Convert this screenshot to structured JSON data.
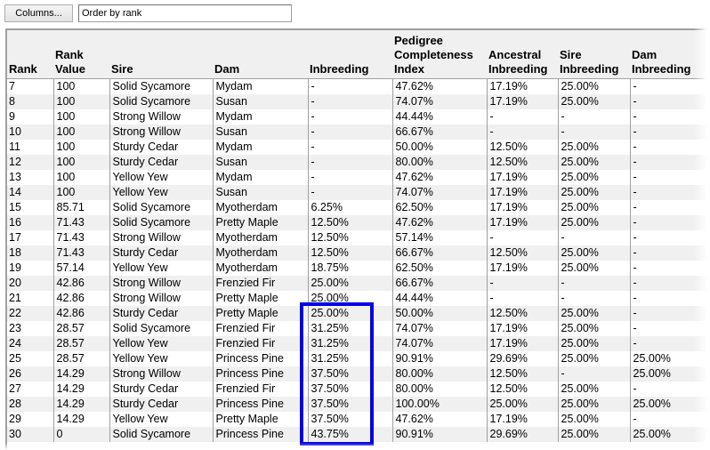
{
  "toolbar": {
    "columns_button": "Columns...",
    "order_field_value": "Order by rank"
  },
  "table": {
    "headers": [
      {
        "line1": "",
        "line2": "",
        "line3": "Rank"
      },
      {
        "line1": "",
        "line2": "Rank",
        "line3": "Value"
      },
      {
        "line1": "",
        "line2": "",
        "line3": "Sire"
      },
      {
        "line1": "",
        "line2": "",
        "line3": "Dam"
      },
      {
        "line1": "",
        "line2": "",
        "line3": "Inbreeding"
      },
      {
        "line1": "Pedigree",
        "line2": "Completeness",
        "line3": "Index"
      },
      {
        "line1": "",
        "line2": "Ancestral",
        "line3": "Inbreeding"
      },
      {
        "line1": "",
        "line2": "Sire",
        "line3": "Inbreeding"
      },
      {
        "line1": "",
        "line2": "Dam",
        "line3": "Inbreeding"
      }
    ],
    "rows": [
      [
        "7",
        "100",
        "Solid Sycamore",
        "Mydam",
        "-",
        "47.62%",
        "17.19%",
        "25.00%",
        "-"
      ],
      [
        "8",
        "100",
        "Solid Sycamore",
        "Susan",
        "-",
        "74.07%",
        "17.19%",
        "25.00%",
        "-"
      ],
      [
        "9",
        "100",
        "Strong Willow",
        "Mydam",
        "-",
        "44.44%",
        "-",
        "-",
        "-"
      ],
      [
        "10",
        "100",
        "Strong Willow",
        "Susan",
        "-",
        "66.67%",
        "-",
        "-",
        "-"
      ],
      [
        "11",
        "100",
        "Sturdy Cedar",
        "Mydam",
        "-",
        "50.00%",
        "12.50%",
        "25.00%",
        "-"
      ],
      [
        "12",
        "100",
        "Sturdy Cedar",
        "Susan",
        "-",
        "80.00%",
        "12.50%",
        "25.00%",
        "-"
      ],
      [
        "13",
        "100",
        "Yellow Yew",
        "Mydam",
        "-",
        "47.62%",
        "17.19%",
        "25.00%",
        "-"
      ],
      [
        "14",
        "100",
        "Yellow Yew",
        "Susan",
        "-",
        "74.07%",
        "17.19%",
        "25.00%",
        "-"
      ],
      [
        "15",
        "85.71",
        "Solid Sycamore",
        "Myotherdam",
        "6.25%",
        "62.50%",
        "17.19%",
        "25.00%",
        "-"
      ],
      [
        "16",
        "71.43",
        "Solid Sycamore",
        "Pretty Maple",
        "12.50%",
        "47.62%",
        "17.19%",
        "25.00%",
        "-"
      ],
      [
        "17",
        "71.43",
        "Strong Willow",
        "Myotherdam",
        "12.50%",
        "57.14%",
        "-",
        "-",
        "-"
      ],
      [
        "18",
        "71.43",
        "Sturdy Cedar",
        "Myotherdam",
        "12.50%",
        "66.67%",
        "12.50%",
        "25.00%",
        "-"
      ],
      [
        "19",
        "57.14",
        "Yellow Yew",
        "Myotherdam",
        "18.75%",
        "62.50%",
        "17.19%",
        "25.00%",
        "-"
      ],
      [
        "20",
        "42.86",
        "Strong Willow",
        "Frenzied Fir",
        "25.00%",
        "66.67%",
        "-",
        "-",
        "-"
      ],
      [
        "21",
        "42.86",
        "Strong Willow",
        "Pretty Maple",
        "25.00%",
        "44.44%",
        "-",
        "-",
        "-"
      ],
      [
        "22",
        "42.86",
        "Sturdy Cedar",
        "Pretty Maple",
        "25.00%",
        "50.00%",
        "12.50%",
        "25.00%",
        "-"
      ],
      [
        "23",
        "28.57",
        "Solid Sycamore",
        "Frenzied Fir",
        "31.25%",
        "74.07%",
        "17.19%",
        "25.00%",
        "-"
      ],
      [
        "24",
        "28.57",
        "Yellow Yew",
        "Frenzied Fir",
        "31.25%",
        "74.07%",
        "17.19%",
        "25.00%",
        "-"
      ],
      [
        "25",
        "28.57",
        "Yellow Yew",
        "Princess Pine",
        "31.25%",
        "90.91%",
        "29.69%",
        "25.00%",
        "25.00%"
      ],
      [
        "26",
        "14.29",
        "Strong Willow",
        "Princess Pine",
        "37.50%",
        "80.00%",
        "12.50%",
        "-",
        "25.00%"
      ],
      [
        "27",
        "14.29",
        "Sturdy Cedar",
        "Frenzied Fir",
        "37.50%",
        "80.00%",
        "12.50%",
        "25.00%",
        "-"
      ],
      [
        "28",
        "14.29",
        "Sturdy Cedar",
        "Princess Pine",
        "37.50%",
        "100.00%",
        "25.00%",
        "25.00%",
        "25.00%"
      ],
      [
        "29",
        "14.29",
        "Yellow Yew",
        "Pretty Maple",
        "37.50%",
        "47.62%",
        "17.19%",
        "25.00%",
        "-"
      ],
      [
        "30",
        "0",
        "Solid Sycamore",
        "Princess Pine",
        "43.75%",
        "90.91%",
        "29.69%",
        "25.00%",
        "25.00%"
      ]
    ]
  },
  "annotation": {
    "highlight_color": "#0000e6",
    "highlighted_column": "Inbreeding",
    "highlighted_rows_from_rank": "22",
    "highlighted_rows_to_rank": "30"
  }
}
